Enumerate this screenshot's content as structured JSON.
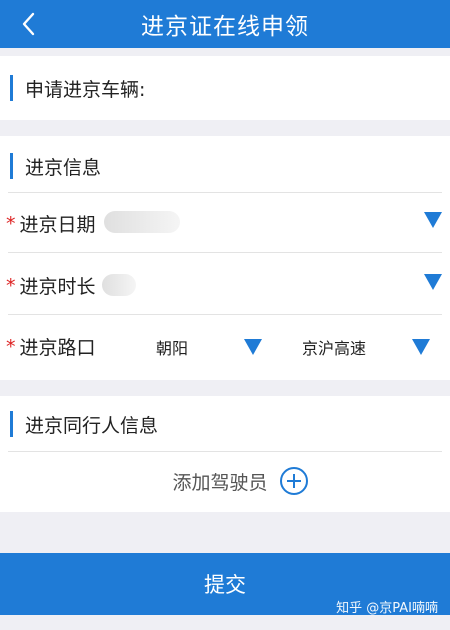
{
  "header": {
    "title": "进京证在线申领",
    "back_icon": "chevron-left-icon"
  },
  "vehicle": {
    "label": "申请进京车辆:"
  },
  "entry_info": {
    "section_title": "进京信息",
    "date_label": "进京日期",
    "duration_label": "进京时长",
    "route_label": "进京路口",
    "route_district": "朝阳",
    "route_road": "京沪高速",
    "required_mark": "*"
  },
  "companion_info": {
    "section_title": "进京同行人信息",
    "add_driver_label": "添加驾驶员"
  },
  "footer": {
    "submit_label": "提交"
  },
  "watermark": "知乎 @京PAI喃喃",
  "colors": {
    "accent": "#1f7bd6",
    "required": "#dd2222",
    "background": "#efeff4"
  }
}
